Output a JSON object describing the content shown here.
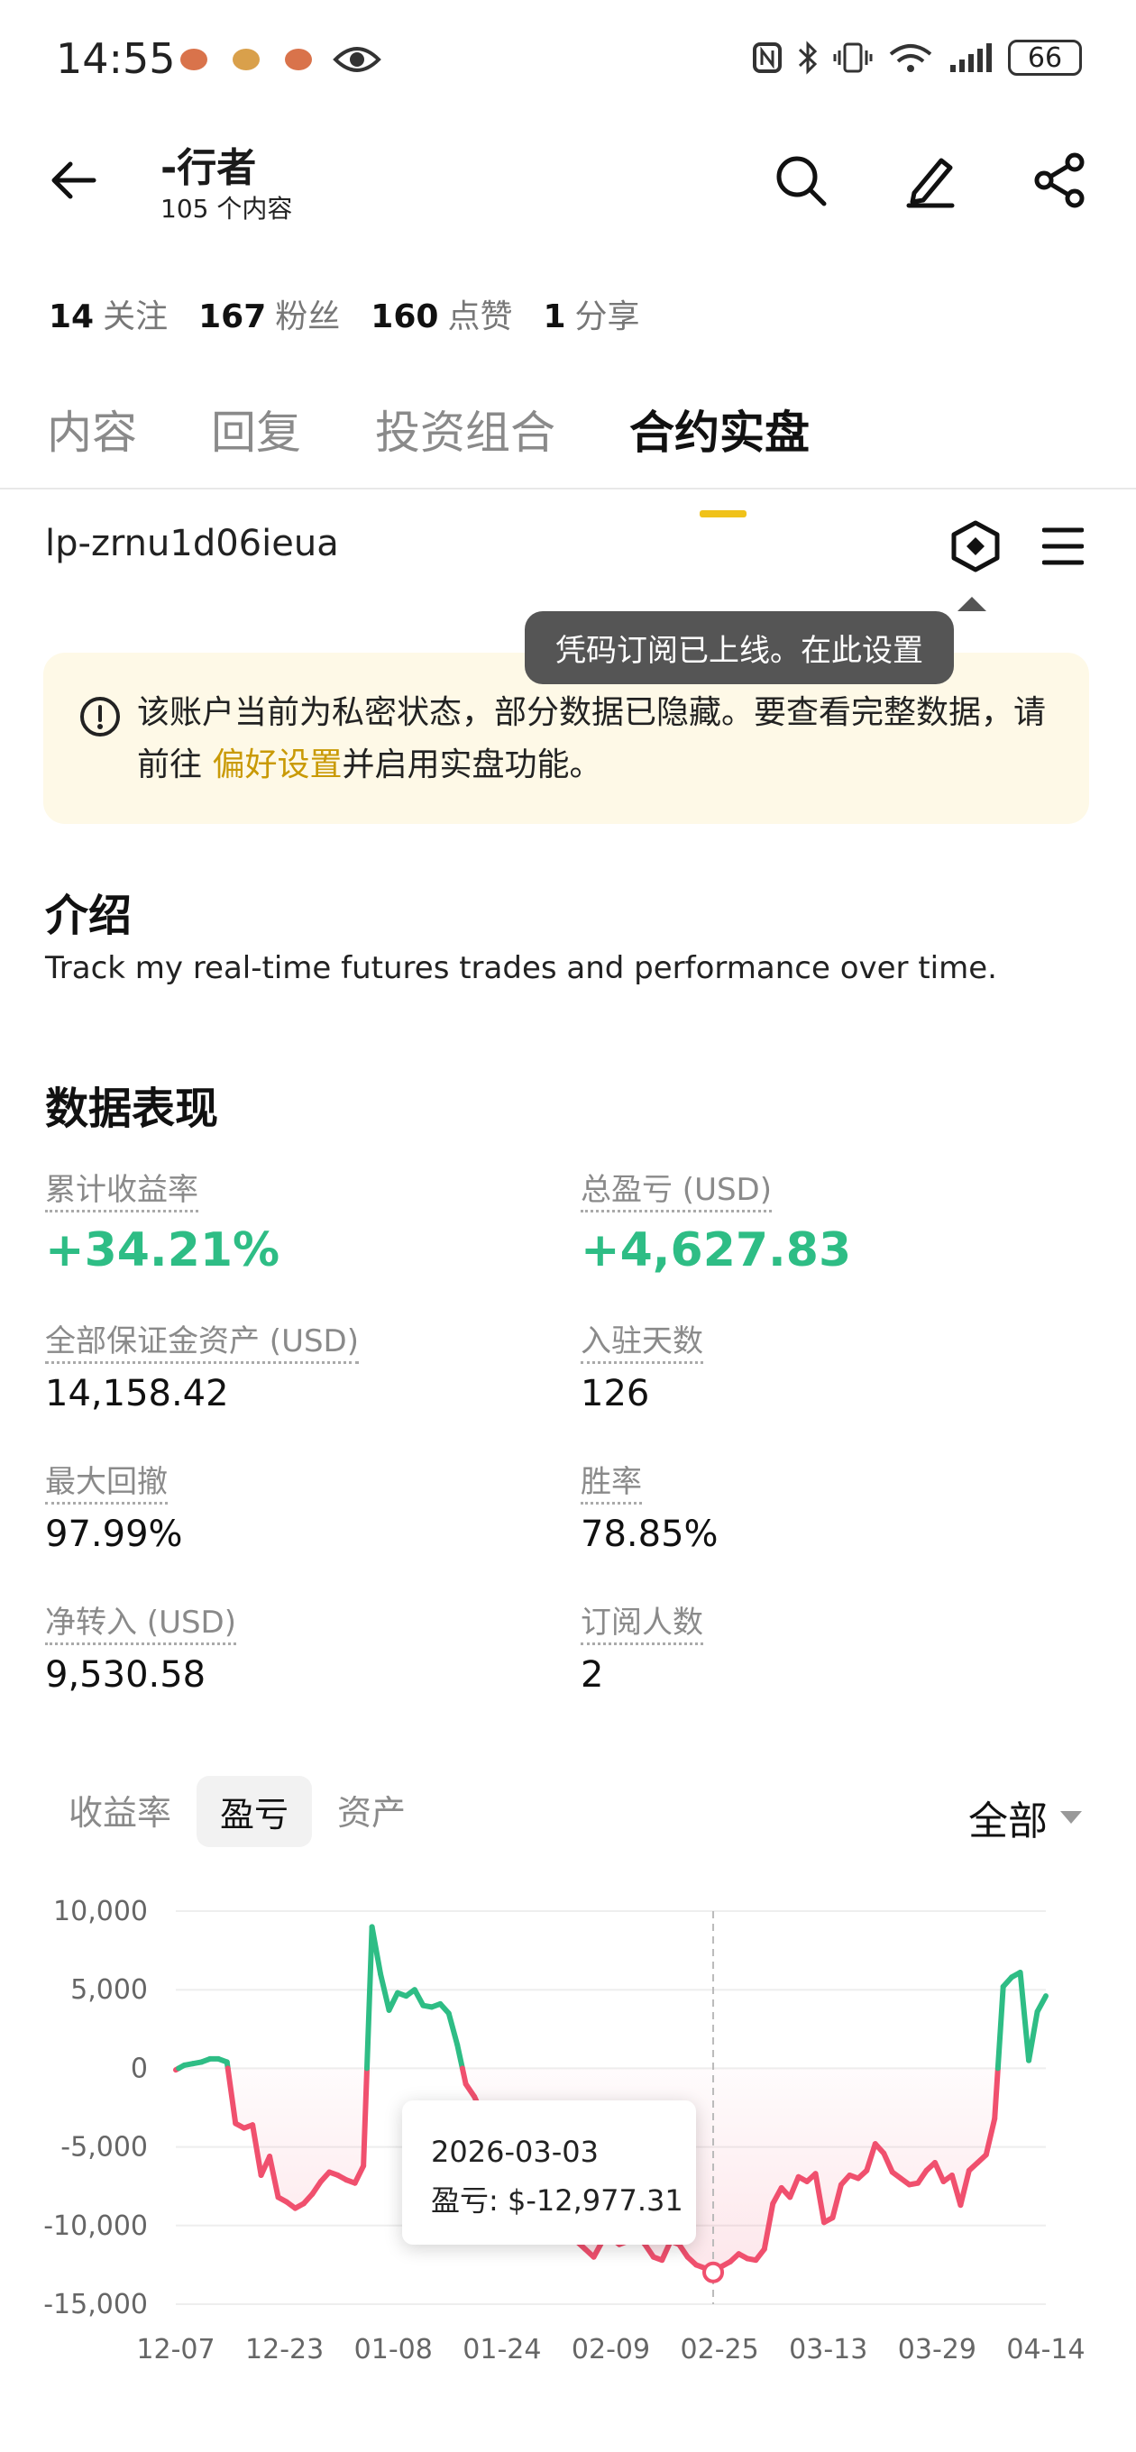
{
  "status_bar": {
    "time": "14:55",
    "battery": "66"
  },
  "header": {
    "title": "-行者",
    "subtitle": "105 个内容"
  },
  "stats": [
    {
      "value": "14",
      "label": "关注"
    },
    {
      "value": "167",
      "label": "粉丝"
    },
    {
      "value": "160",
      "label": "点赞"
    },
    {
      "value": "1",
      "label": "分享"
    }
  ],
  "tabs": [
    "内容",
    "回复",
    "投资组合",
    "合约实盘"
  ],
  "account": {
    "id": "lp-zrnu1d06ieua",
    "tooltip": "凭码订阅已上线。在此设置"
  },
  "notice": {
    "before": "该账户当前为私密状态，部分数据已隐藏。要查看完整数据，请前往 ",
    "link": "偏好设置",
    "after": "并启用实盘功能。"
  },
  "intro": {
    "heading": "介绍",
    "text": "Track my real-time futures trades and performance over time."
  },
  "performance": {
    "heading": "数据表现",
    "metrics": [
      {
        "label": "累计收益率",
        "value": "+34.21%"
      },
      {
        "label": "总盈亏 (USD)",
        "value": "+4,627.83"
      },
      {
        "label": "全部保证金资产 (USD)",
        "value": "14,158.42"
      },
      {
        "label": "入驻天数",
        "value": "126"
      },
      {
        "label": "最大回撤",
        "value": "97.99%"
      },
      {
        "label": "胜率",
        "value": "78.85%"
      },
      {
        "label": "净转入 (USD)",
        "value": "9,530.58"
      },
      {
        "label": "订阅人数",
        "value": "2"
      }
    ]
  },
  "chart_tabs": [
    "收益率",
    "盈亏",
    "资产"
  ],
  "range": "全部",
  "tooltip": {
    "date": "2026-03-03",
    "label": "盈亏: $-12,977.31"
  },
  "colors": {
    "positive": "#2ebd85",
    "negative": "#f0506e",
    "accent": "#f0c21a"
  },
  "chart_data": {
    "type": "area",
    "y_ticks": [
      "10,000",
      "5,000",
      "0",
      "-5,000",
      "-10,000",
      "-15,000"
    ],
    "ylim": [
      -15000,
      10000
    ],
    "x_ticks": [
      "12-07",
      "12-23",
      "01-08",
      "01-24",
      "02-09",
      "02-25",
      "03-13",
      "03-29",
      "04-14"
    ],
    "series": [
      {
        "values": [
          -100,
          200,
          300,
          400,
          600,
          600,
          400,
          -3500,
          -3800,
          -3600,
          -6800,
          -5600,
          -8200,
          -8500,
          -8900,
          -8600,
          -8000,
          -7200,
          -6600,
          -6800,
          -7100,
          -7300,
          -6200,
          9000,
          6000,
          3700,
          4800,
          4600,
          5000,
          4000,
          3900,
          4100,
          3500,
          1500,
          -1000,
          -1800,
          -3000,
          -4000,
          -5000,
          -5500,
          -6500,
          -7000,
          -8000,
          -8500,
          -9500,
          -10000,
          -10500,
          -11000,
          -11500,
          -12000,
          -11000,
          -10800,
          -11200,
          -11000,
          -10500,
          -11200,
          -12000,
          -12200,
          -11000,
          -11200,
          -12000,
          -12500,
          -12700,
          -12977,
          -12600,
          -12300,
          -11800,
          -12100,
          -12200,
          -11500,
          -8600,
          -7600,
          -8200,
          -6900,
          -7200,
          -6700,
          -9800,
          -9500,
          -7400,
          -6800,
          -7000,
          -6500,
          -4800,
          -5400,
          -6600,
          -7000,
          -7400,
          -7300,
          -6500,
          -6000,
          -7200,
          -6800,
          -8700,
          -6500,
          -6000,
          -5500,
          -3200,
          5200,
          5800,
          6100,
          500,
          3600,
          4600
        ]
      }
    ]
  }
}
